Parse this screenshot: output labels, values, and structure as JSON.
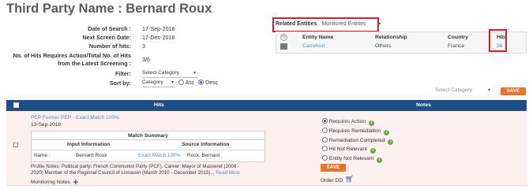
{
  "title": "Third Party Name : Bernard Roux",
  "info": {
    "date_of_search_label": "Date of Search :",
    "date_of_search": "17-Sep-2018",
    "next_screen_label": "Next Screen Date:",
    "next_screen": "17-Dec-2018",
    "hits_label": "Number of hits:",
    "hits": "3",
    "ratio_label": "No. of Hits Requires Action/Total No. of Hits from the Latest Screening :",
    "ratio": "3/6",
    "filter_label": "Filter:",
    "filter_value": "Select Category",
    "sort_label": "Sort by:",
    "sort_value": "Category",
    "asc_label": "Asc",
    "desc_label": "Desc",
    "sort_order": "Desc"
  },
  "related": {
    "label": "Related Entities",
    "select_value": "Monitored Entities",
    "headers": {
      "name": "Entity Name",
      "relationship": "Relationship",
      "country": "Country",
      "hits": "Hits"
    },
    "row": {
      "name": "Carrefour",
      "relationship": "Others",
      "country": "France",
      "hits": "36"
    }
  },
  "right_controls": {
    "category_placeholder": "Select Category",
    "save_label": "SAVE"
  },
  "grid": {
    "hits_header": "Hits",
    "notes_header": "Notes",
    "row": {
      "hit_title": "PEP Former PEP - Exact Match 100%",
      "hit_date": "13-Sep-2018",
      "match_summary_title": "Match Summary",
      "input_header": "Input Information",
      "source_header": "Source Information",
      "name_label": "Name :",
      "input_name": "Bernard Roux",
      "match_text": "Exact Match 100%",
      "source_name": "Roux, Bernard",
      "profile_notes_line1": "Profile Notes: Political party: French Communist Party (PCF). Career: Mayor of Masseret (2008 -",
      "profile_notes_line2": "2020) Member of the Regional Council of Limousin (March 2010 - December 2015)... ",
      "read_more": "Read More",
      "monitoring_notes": "Monitoring Notes",
      "options": [
        "Requires Action",
        "Requires Remediation",
        "Remediation Completed",
        "Hit Not Relevant",
        "Entity Not Relevant"
      ],
      "selected_option": "Requires Action",
      "save_label": "SAVE",
      "order_dd": "Order DD"
    }
  },
  "colors": {
    "accent": "#e8732c",
    "header_blue": "#1d4f86",
    "highlight_red": "#d0202a",
    "link_blue": "#4a90c8",
    "row_bg": "#fdf0ef"
  },
  "icons": {
    "entity_avatar": "entity-avatar-icon",
    "building": "building-icon",
    "info": "info-icon",
    "add": "plus-icon",
    "cart": "cart-icon"
  }
}
